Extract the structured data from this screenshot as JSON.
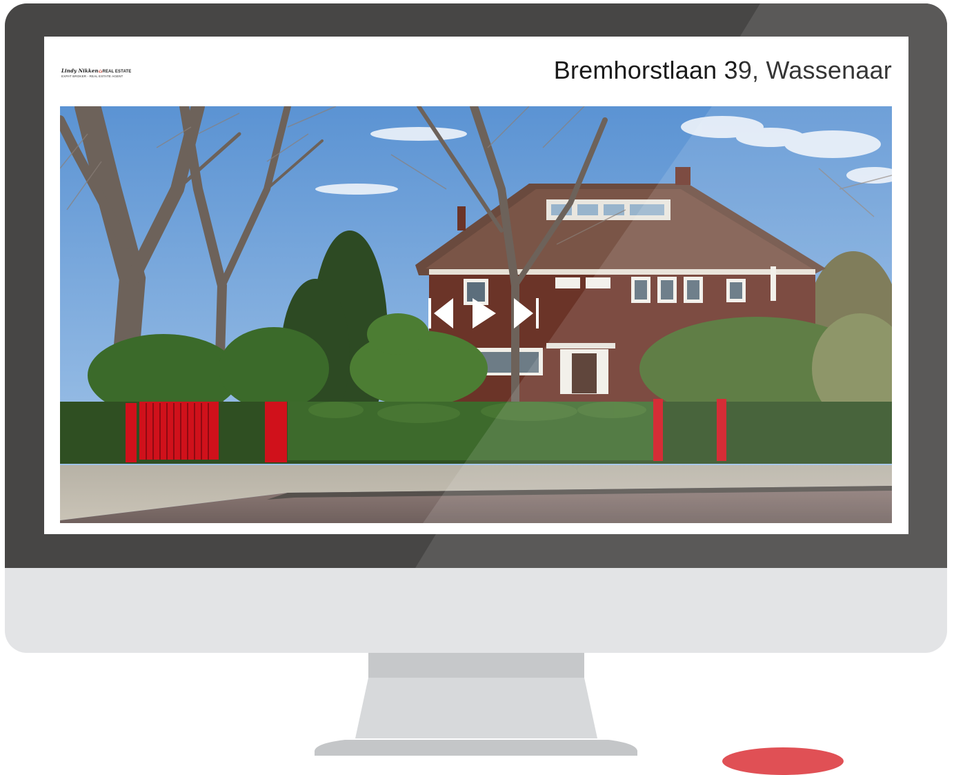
{
  "logo": {
    "name": "Lindy Nikken",
    "brand_suffix": "REAL ESTATE",
    "tagline": "EXPAT BROKER - REAL ESTATE AGENT"
  },
  "listing": {
    "address": "Bremhorstlaan 39, Wassenaar"
  },
  "slideshow": {
    "controls": [
      "previous-icon",
      "play-icon",
      "next-icon"
    ]
  },
  "colors": {
    "bezel": "#474645",
    "chin": "#e3e4e6",
    "stand": "#c6c8ca",
    "brand_red": "#c0392b",
    "gate_red": "#d0111b"
  }
}
